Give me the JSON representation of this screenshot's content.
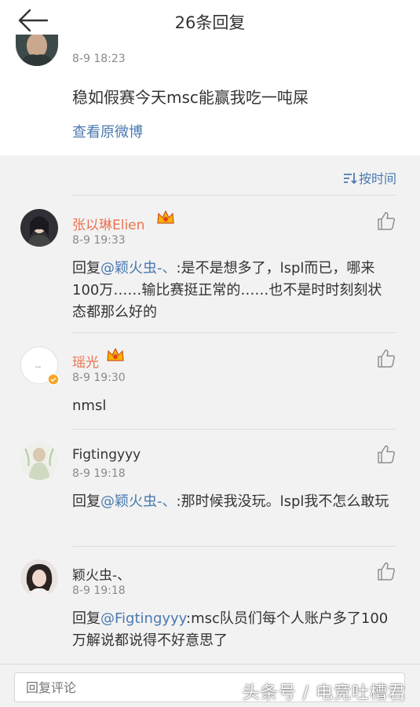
{
  "header": {
    "title": "26条回复",
    "back_icon": "arrow-left-icon"
  },
  "original": {
    "time": "8-9  18:23",
    "text": "稳如假赛今天msc能赢我吃一吨屎",
    "view_link": "查看原微博"
  },
  "sort": {
    "label": "按时间",
    "icon": "sort-icon"
  },
  "comments": [
    {
      "name": "张以琳Elien",
      "vip": true,
      "time": "8-9  19:33",
      "reply_prefix": "回复",
      "mention": "@颖火虫-、",
      "body": ":是不是想多了，lspl而已，哪来100万……输比赛挺正常的……也不是时时刻刻状态都那么好的"
    },
    {
      "name": "瑶光",
      "vip": true,
      "time": "8-9  19:30",
      "reply_prefix": "",
      "mention": "",
      "body": "nmsl"
    },
    {
      "name": "Figtingyyy",
      "vip": false,
      "time": "8-9  19:18",
      "reply_prefix": "回复",
      "mention": "@颖火虫-、",
      "body": ":那时候我没玩。lspl我不怎么敢玩"
    },
    {
      "name": "颖火虫-、",
      "vip": false,
      "time": "8-9  19:18",
      "reply_prefix": "回复",
      "mention": "@Figtingyyy",
      "body": ":msc队员们每个人账户多了100万解说都说得不好意思了"
    }
  ],
  "reply_box": {
    "placeholder": "回复评论"
  },
  "watermark": "头条号 / 电竞吐槽君",
  "colors": {
    "link": "#4a79b0",
    "vip_name": "#eb7350",
    "background": "#f2f2f2"
  }
}
